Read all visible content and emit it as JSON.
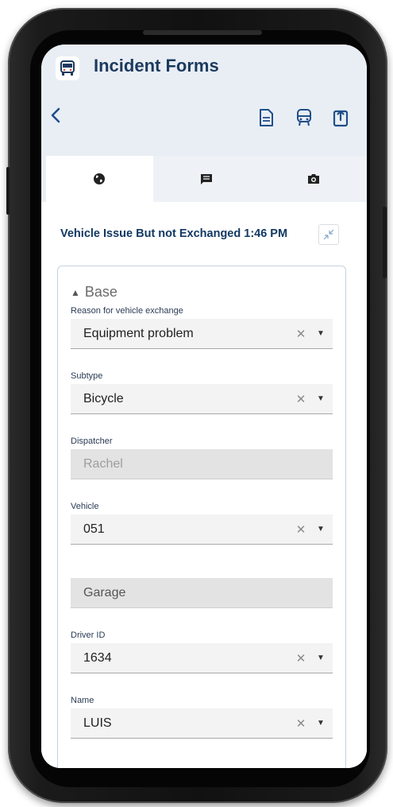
{
  "app": {
    "title": "Incident Forms",
    "logo_icon": "bus-logo-icon"
  },
  "toolbar": {
    "back_icon": "chevron-left-icon",
    "actions": [
      "document-icon",
      "bus-icon",
      "upload-icon"
    ]
  },
  "tabs": [
    {
      "icon": "globe-icon",
      "active": true
    },
    {
      "icon": "message-icon",
      "active": false
    },
    {
      "icon": "camera-icon",
      "active": false
    }
  ],
  "form": {
    "title": "Vehicle Issue But not Exchanged 1:46 PM",
    "section": {
      "title": "Base",
      "arrow": "▲"
    },
    "fields": {
      "reason": {
        "label": "Reason for vehicle exchange",
        "value": "Equipment problem"
      },
      "subtype": {
        "label": "Subtype",
        "value": "Bicycle"
      },
      "dispatcher": {
        "label": "Dispatcher",
        "placeholder": "Rachel"
      },
      "vehicle": {
        "label": "Vehicle",
        "value": "051"
      },
      "garage": {
        "placeholder": "Garage"
      },
      "driver_id": {
        "label": "Driver ID",
        "value": "1634"
      },
      "name": {
        "label": "Name",
        "value": "LUIS"
      }
    },
    "clear_glyph": "✕",
    "dropdown_glyph": "▼"
  },
  "colors": {
    "brand": "#1c3a5e",
    "accent_blue": "#1f4f8a",
    "header_bg": "#e9eef4"
  }
}
